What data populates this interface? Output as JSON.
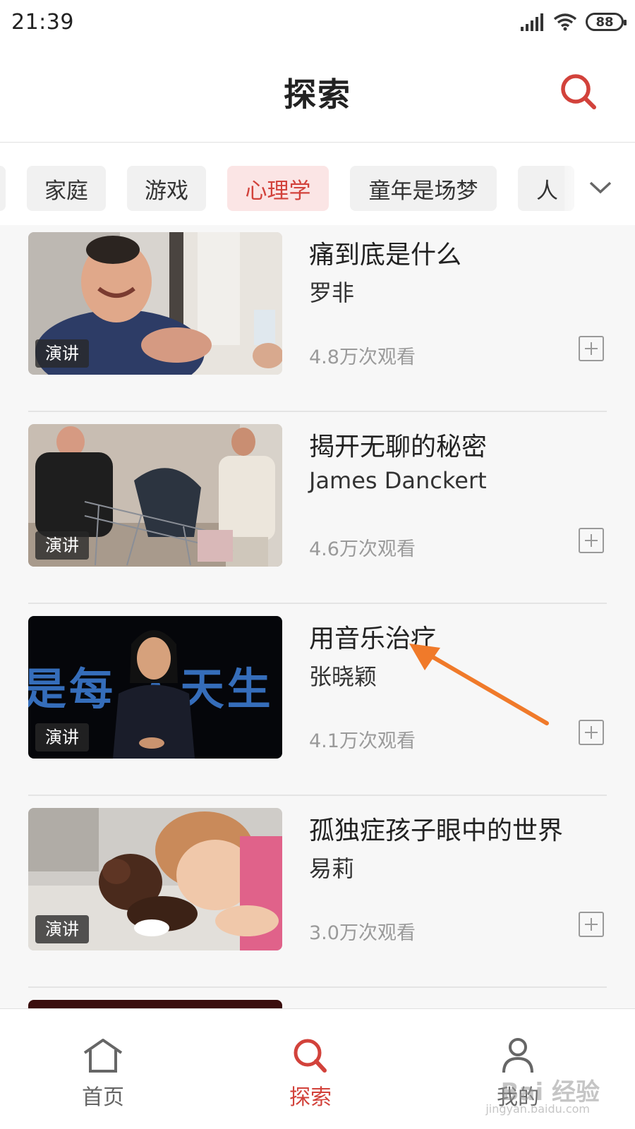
{
  "status_bar": {
    "time": "21:39",
    "battery": "88"
  },
  "header": {
    "title": "探索"
  },
  "categories": [
    {
      "label": "家庭",
      "active": false
    },
    {
      "label": "游戏",
      "active": false
    },
    {
      "label": "心理学",
      "active": true
    },
    {
      "label": "童年是场梦",
      "active": false
    },
    {
      "label": "人",
      "active": false
    }
  ],
  "list_items": [
    {
      "title": "痛到底是什么",
      "author": "罗非",
      "views": "4.8万次观看",
      "badge": "演讲"
    },
    {
      "title": "揭开无聊的秘密",
      "author": "James Danckert",
      "views": "4.6万次观看",
      "badge": "演讲"
    },
    {
      "title": "用音乐治疗",
      "author": "张晓颖",
      "views": "4.1万次观看",
      "badge": "演讲"
    },
    {
      "title": "孤独症孩子眼中的世界",
      "author": "易莉",
      "views": "3.0万次观看",
      "badge": "演讲"
    }
  ],
  "thumbnail_text": "是每 人天生",
  "bottom_nav": [
    {
      "label": "首页",
      "icon": "home-icon",
      "active": false
    },
    {
      "label": "探索",
      "icon": "search-icon",
      "active": true
    },
    {
      "label": "我的",
      "icon": "person-icon",
      "active": false
    }
  ],
  "watermark": {
    "brand": "Bai 经验",
    "url": "jingyan.baidu.com"
  },
  "colors": {
    "accent": "#d2423b",
    "arrow": "#f07a2a",
    "active_tab_bg": "#fbe5e5"
  }
}
